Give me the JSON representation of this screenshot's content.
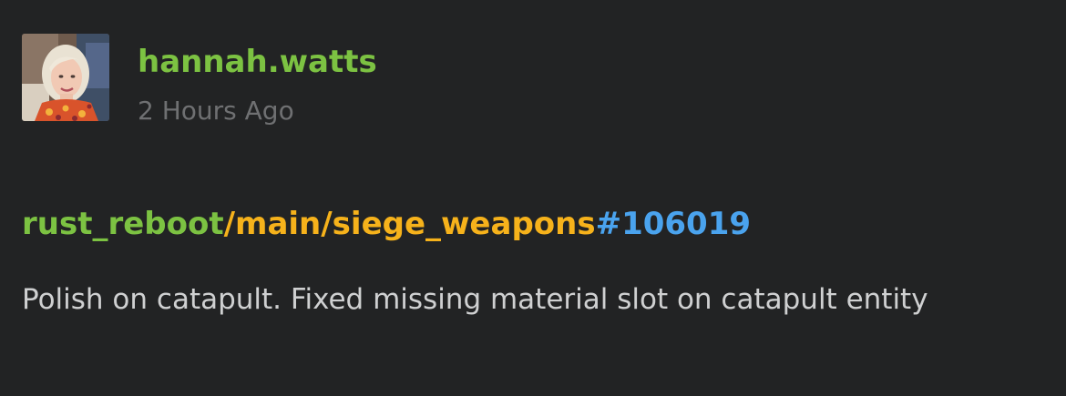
{
  "post": {
    "author": "hannah.watts",
    "timestamp": "2 Hours Ago",
    "avatar": "user-avatar-photo",
    "commit": {
      "project": "rust_reboot",
      "path": "/main/siege_weapons",
      "changelist": "#106019"
    },
    "message": "Polish on catapult. Fixed missing material slot on catapult entity"
  },
  "colors": {
    "background": "#222324",
    "author": "#7cc242",
    "project": "#7cc242",
    "path": "#f6b21b",
    "changelist": "#4aa3ee",
    "timestamp": "#6f7072",
    "message": "#cfd0d1"
  }
}
